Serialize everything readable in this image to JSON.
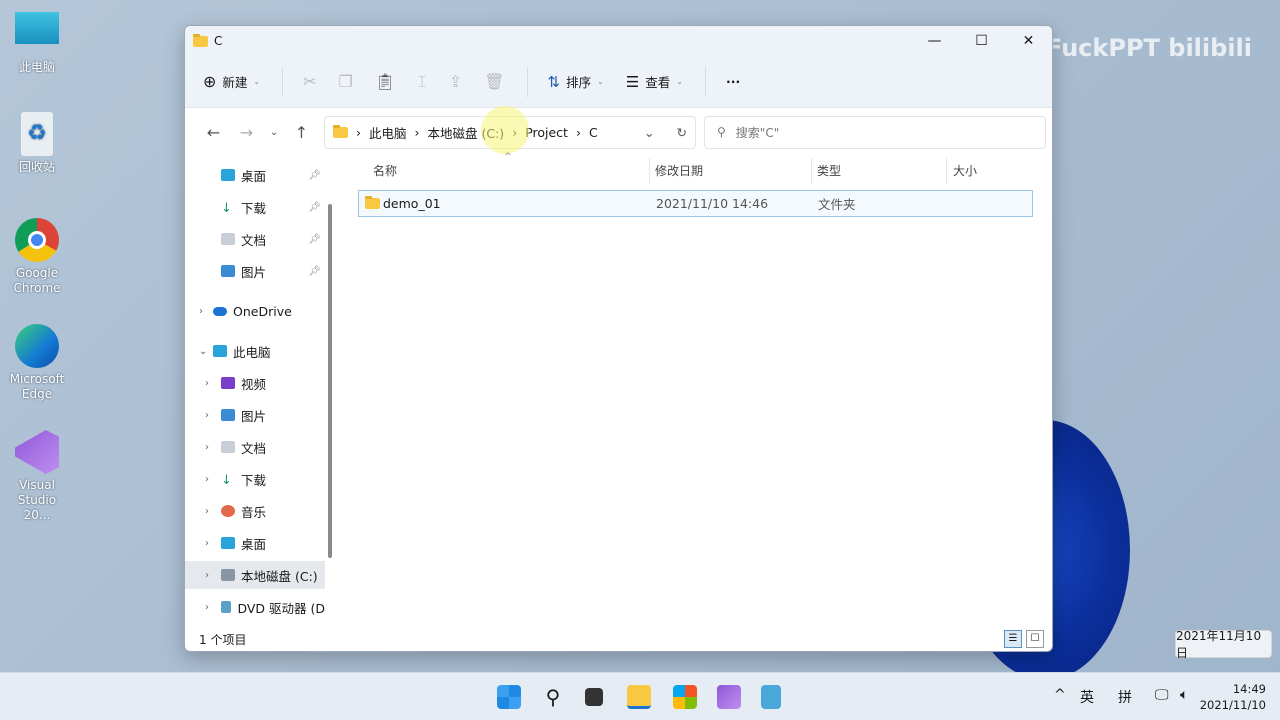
{
  "desktop": {
    "icons": [
      {
        "label": "此电脑"
      },
      {
        "label": "回收站"
      },
      {
        "label": "Google Chrome"
      },
      {
        "label": "Microsoft Edge"
      },
      {
        "label": "Visual Studio 20..."
      }
    ]
  },
  "window": {
    "title": "C",
    "toolbar": {
      "new": "新建",
      "sort": "排序",
      "view": "查看",
      "more": "···"
    },
    "address": {
      "crumbs": [
        "此电脑",
        "本地磁盘 (C:)",
        "Project",
        "C"
      ],
      "search_placeholder": "搜索\"C\""
    },
    "nav": {
      "quick": [
        {
          "label": "桌面"
        },
        {
          "label": "下载"
        },
        {
          "label": "文档"
        },
        {
          "label": "图片"
        }
      ],
      "onedrive": "OneDrive",
      "pc": "此电脑",
      "pc_items": [
        {
          "label": "视频"
        },
        {
          "label": "图片"
        },
        {
          "label": "文档"
        },
        {
          "label": "下载"
        },
        {
          "label": "音乐"
        },
        {
          "label": "桌面"
        },
        {
          "label": "本地磁盘 (C:)"
        },
        {
          "label": "DVD 驱动器 (D"
        }
      ]
    },
    "columns": {
      "name": "名称",
      "date": "修改日期",
      "type": "类型",
      "size": "大小"
    },
    "files": [
      {
        "name": "demo_01",
        "date": "2021/11/10 14:46",
        "type": "文件夹",
        "size": ""
      }
    ],
    "status": "1 个项目"
  },
  "tooltip": "2021年11月10日",
  "taskbar": {
    "lang": "英",
    "ime": "拼",
    "time": "14:49",
    "date": "2021/11/10"
  }
}
